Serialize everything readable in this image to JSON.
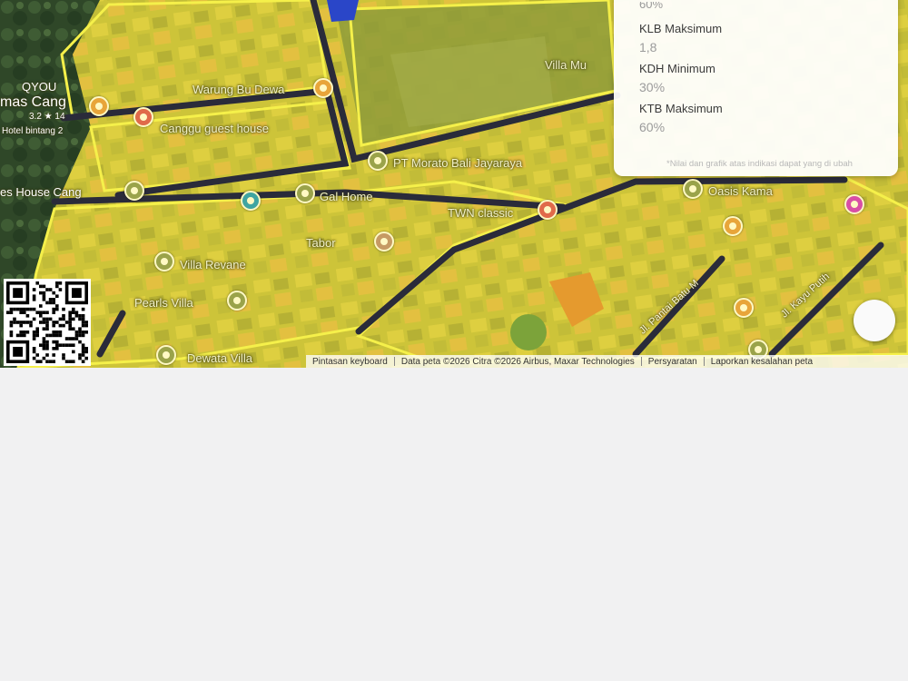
{
  "map": {
    "labels": {
      "warung": "Warung Bu Dewa",
      "guesthouse": "Canggu guest house",
      "morato": "PT Morato Bali Jayaraya",
      "home": "Gal Home",
      "twn": "TWN classic",
      "tabor": "Tabor",
      "villarevane": "Villa Revane",
      "pearls": "Pearls Villa",
      "dewata": "Dewata Villa",
      "villamu": "Villa Mu",
      "oasis": "Oasis Kama",
      "qyou": "QYOU",
      "mascang": "mas Cang",
      "rating": "3.2 ★ 14",
      "hotelbintang": "Hotel bintang 2",
      "hostelcang": "es House Cang",
      "street_a": "Jl. Pantai Batu M",
      "street_b": "Jl. Kayu Putih"
    },
    "poi_icons": [
      "restaurant-icon",
      "hotel-icon",
      "shop-icon",
      "pin-icon"
    ]
  },
  "info_panel": {
    "truncated_value": "60%",
    "rows": [
      {
        "label": "KLB Maksimum",
        "value": "1,8"
      },
      {
        "label": "KDH Minimum",
        "value": "30%"
      },
      {
        "label": "KTB Maksimum",
        "value": "60%"
      }
    ],
    "footnote": "*Nilai dan grafik atas indikasi dapat yang di ubah"
  },
  "attribution": {
    "keyboard": "Pintasan keyboard",
    "data": "Data peta ©2026 Citra ©2026 Airbus, Maxar Technologies",
    "terms": "Persyaratan",
    "report": "Laporkan kesalahan peta"
  }
}
